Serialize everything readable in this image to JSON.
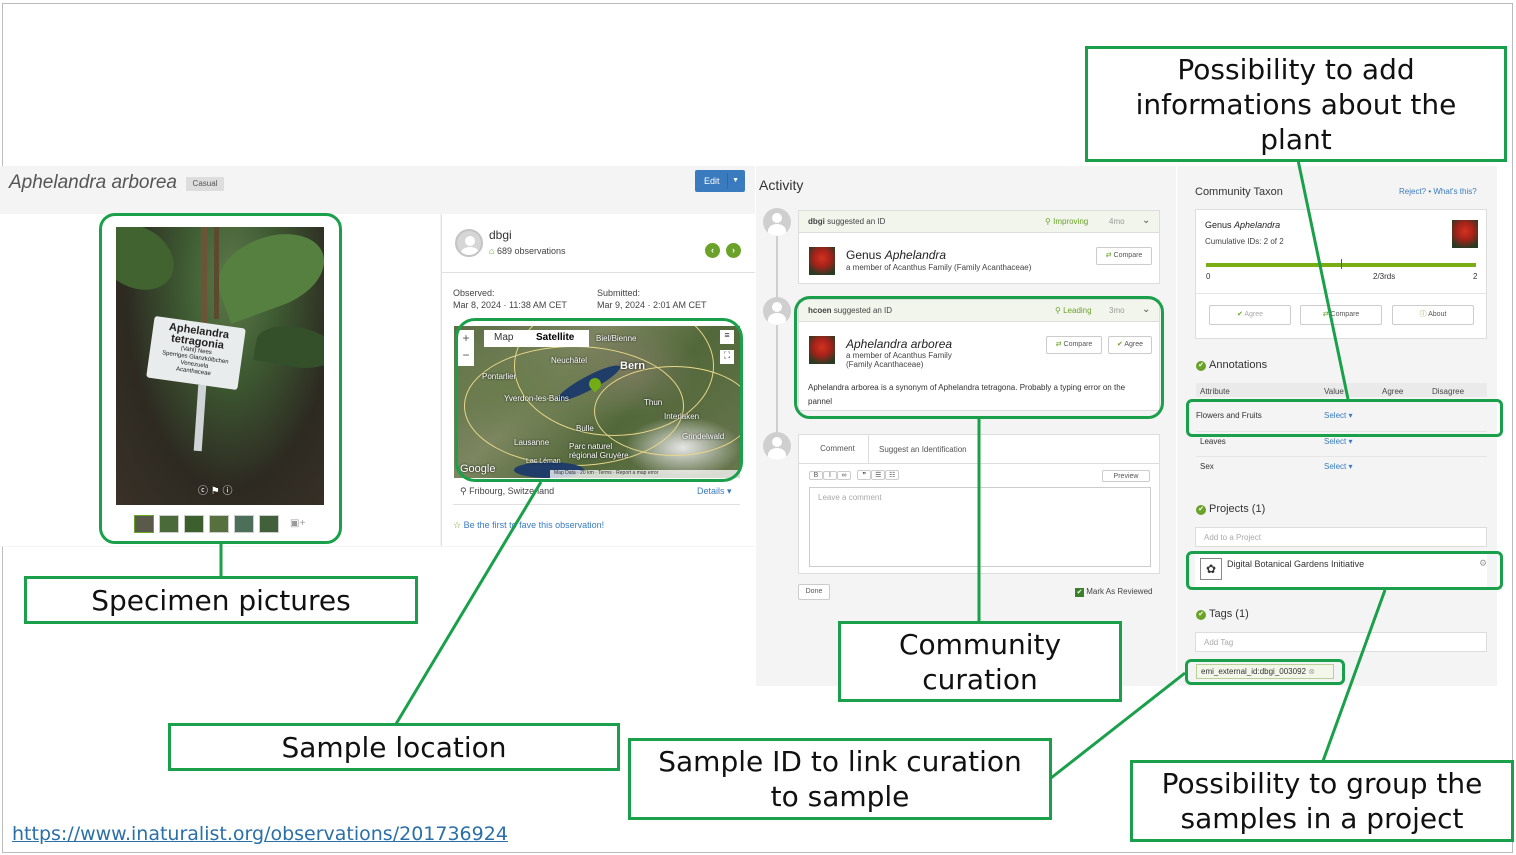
{
  "observation": {
    "title": "Aphelandra arborea",
    "quality_badge": "Casual",
    "edit_label": "Edit",
    "user": "dbgi",
    "user_observations": "689 observations",
    "observed_label": "Observed:",
    "observed_value": "Mar 8, 2024 · 11:38 AM CET",
    "submitted_label": "Submitted:",
    "submitted_value": "Mar 9, 2024 · 2:01 AM CET",
    "location": "Fribourg, Switzerland",
    "details_label": "Details ▾",
    "fave_text": "Be the first to fave this observation!",
    "plaque": {
      "line1": "Aphelandra",
      "line2": "tetragonia",
      "line3": "(Vahl) Nees",
      "line4": "Sperriges Glanzkölbchen",
      "line5": "Venezuela",
      "line6": "Acanthaceae"
    }
  },
  "map": {
    "map_tab": "Map",
    "satellite_tab": "Satellite",
    "labels": [
      "Bern",
      "Neuchâtel",
      "Pontarlier",
      "Yverdon-les-Bains",
      "Thun",
      "Interlaken",
      "Lausanne",
      "Bulle",
      "Parc naturel régional Gruyère",
      "Lac Léman",
      "Grindelwald",
      "Biel/Bienne"
    ],
    "attribution": "Map Data · 20 km · Terms · Report a map error",
    "google": "Google"
  },
  "activity": {
    "heading": "Activity",
    "items": [
      {
        "user": "dbgi",
        "action": "suggested an ID",
        "status": "Improving",
        "age": "4mo",
        "taxon_rank": "Genus",
        "taxon_name": "Aphelandra",
        "member_of": "a member of",
        "family": "Acanthus Family (Family Acanthaceae)",
        "compare": "Compare"
      },
      {
        "user": "hcoen",
        "action": "suggested an ID",
        "status": "Leading",
        "age": "3mo",
        "taxon_name": "Aphelandra arborea",
        "member_of": "a member of",
        "family": "Acanthus Family",
        "family2": "(Family Acanthaceae)",
        "compare": "Compare",
        "agree": "Agree",
        "comment": "Aphelandra arborea is a synonym of Aphelandra tetragona. Probably a typing error on the pannel"
      }
    ],
    "comment_tab": "Comment",
    "suggest_tab": "Suggest an Identification",
    "preview": "Preview",
    "comment_placeholder": "Leave a comment",
    "done": "Done",
    "mark_reviewed": "Mark As Reviewed",
    "toolbar": [
      "B",
      "I",
      "∞",
      "❞",
      "☰",
      "☷"
    ]
  },
  "community": {
    "heading": "Community Taxon",
    "reject": "Reject?",
    "whats_this": "What's this?",
    "taxon_rank": "Genus",
    "taxon_name": "Aphelandra",
    "cumulative": "Cumulative IDs: 2 of 2",
    "scale_min": "0",
    "scale_mid": "2/3rds",
    "scale_max": "2",
    "agree": "Agree",
    "compare": "Compare",
    "about": "About"
  },
  "annotations": {
    "heading": "Annotations",
    "columns": [
      "Attribute",
      "Value",
      "Agree",
      "Disagree"
    ],
    "rows": [
      {
        "attribute": "Flowers and Fruits",
        "value": "Select ▾"
      },
      {
        "attribute": "Leaves",
        "value": "Select ▾"
      },
      {
        "attribute": "Sex",
        "value": "Select ▾"
      }
    ]
  },
  "projects": {
    "heading": "Projects (1)",
    "placeholder": "Add to a Project",
    "item": "Digital Botanical Gardens Initiative"
  },
  "tags": {
    "heading": "Tags (1)",
    "placeholder": "Add Tag",
    "tag": "emi_external_id:dbgi_003092"
  },
  "callouts": {
    "add_info": "Possibility to add informations about the plant",
    "specimen": "Specimen pictures",
    "location": "Sample location",
    "curation": "Community curation",
    "sample_id": "Sample ID to link curation to sample",
    "group": "Possibility to group the samples in a project"
  },
  "source_url": "https://www.inaturalist.org/observations/201736924",
  "colors": {
    "accent_green": "#1aa04a",
    "inat_green": "#74ac00",
    "link_blue": "#3a7bbf"
  }
}
